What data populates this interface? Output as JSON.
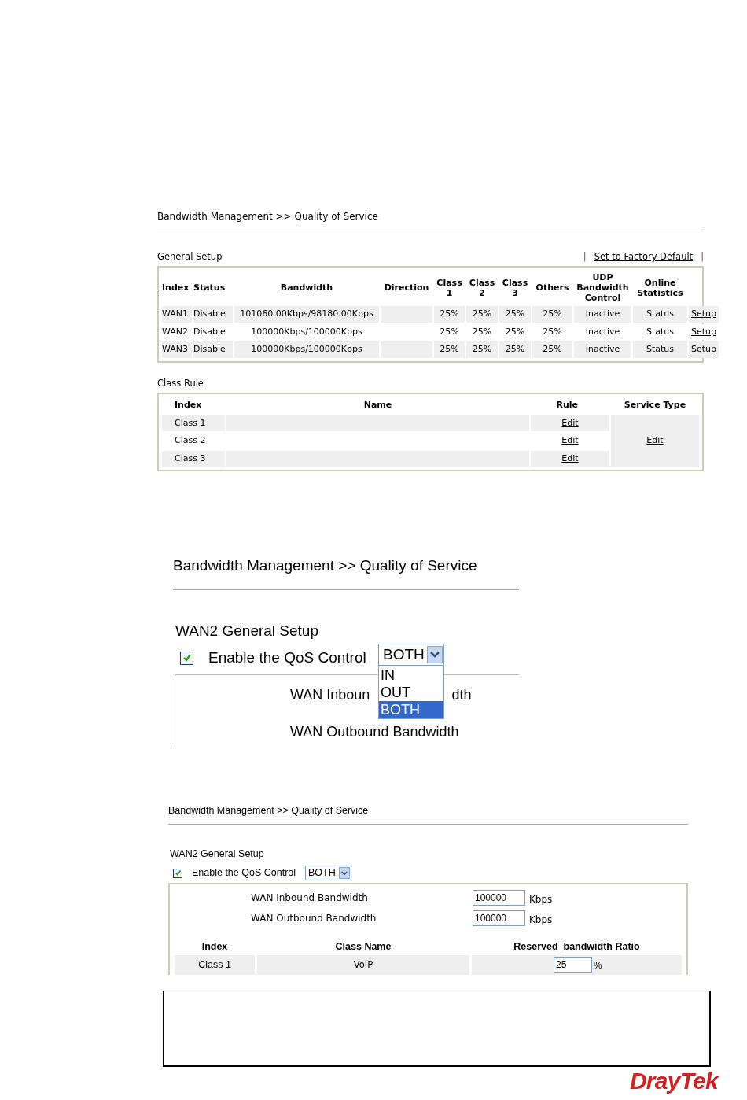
{
  "qos_overview": {
    "title": "Bandwidth Management >> Quality of Service",
    "general_setup": {
      "heading": "General Setup",
      "separator": "|",
      "factory_default_link": "Set to Factory Default",
      "columns": [
        "Index",
        "Status",
        "Bandwidth",
        "Direction",
        "Class 1",
        "Class 2",
        "Class 3",
        "Others",
        "UDP Bandwidth Control",
        "Online Statistics"
      ],
      "rows": [
        {
          "cells": [
            "WAN1",
            "Disable",
            "101060.00Kbps/98180.00Kbps",
            "",
            "25%",
            "25%",
            "25%",
            "25%",
            "Inactive",
            "Status"
          ],
          "link": "Setup"
        },
        {
          "cells": [
            "WAN2",
            "Disable",
            "100000Kbps/100000Kbps",
            "",
            "25%",
            "25%",
            "25%",
            "25%",
            "Inactive",
            "Status"
          ],
          "link": "Setup"
        },
        {
          "cells": [
            "WAN3",
            "Disable",
            "100000Kbps/100000Kbps",
            "",
            "25%",
            "25%",
            "25%",
            "25%",
            "Inactive",
            "Status"
          ],
          "link": "Setup"
        }
      ]
    },
    "class_rule": {
      "heading": "Class Rule",
      "columns": [
        "Index",
        "Name",
        "Rule",
        "Service Type"
      ],
      "rows": [
        {
          "index": "Class 1",
          "rule_link": "Edit"
        },
        {
          "index": "Class 2",
          "rule_link": "Edit"
        },
        {
          "index": "Class 3",
          "rule_link": "Edit"
        }
      ],
      "service_type_link": "Edit"
    }
  },
  "direction_dropdown": {
    "title": "Bandwidth Management >> Quality of Service",
    "heading": "WAN2 General Setup",
    "qos_control": {
      "label": "Enable the QoS Control",
      "checked": true
    },
    "direction_select": {
      "value": "BOTH"
    },
    "options": [
      {
        "label": "IN",
        "selected": false
      },
      {
        "label": "OUT",
        "selected": false
      },
      {
        "label": "BOTH",
        "selected": true
      }
    ],
    "inbound_label_start": "WAN Inboun",
    "inbound_label_end": "dth",
    "outbound_label": "WAN Outbound Bandwidth"
  },
  "wan2_setup": {
    "title": "Bandwidth Management >> Quality of Service",
    "heading": "WAN2 General Setup",
    "qos_control": {
      "label": "Enable the QoS Control",
      "checked": true
    },
    "direction_select": {
      "value": "BOTH"
    },
    "bandwidths": [
      {
        "label": "WAN Inbound Bandwidth",
        "value": "100000",
        "unit": "Kbps"
      },
      {
        "label": "WAN Outbound Bandwidth",
        "value": "100000",
        "unit": "Kbps"
      }
    ],
    "columns": [
      "Index",
      "Class Name",
      "Reserved_bandwidth Ratio"
    ],
    "rows": [
      {
        "index": "Class 1",
        "name": "VoIP",
        "ratio": "25",
        "unit": "%"
      }
    ]
  },
  "logo": {
    "text": "DrayTek"
  }
}
